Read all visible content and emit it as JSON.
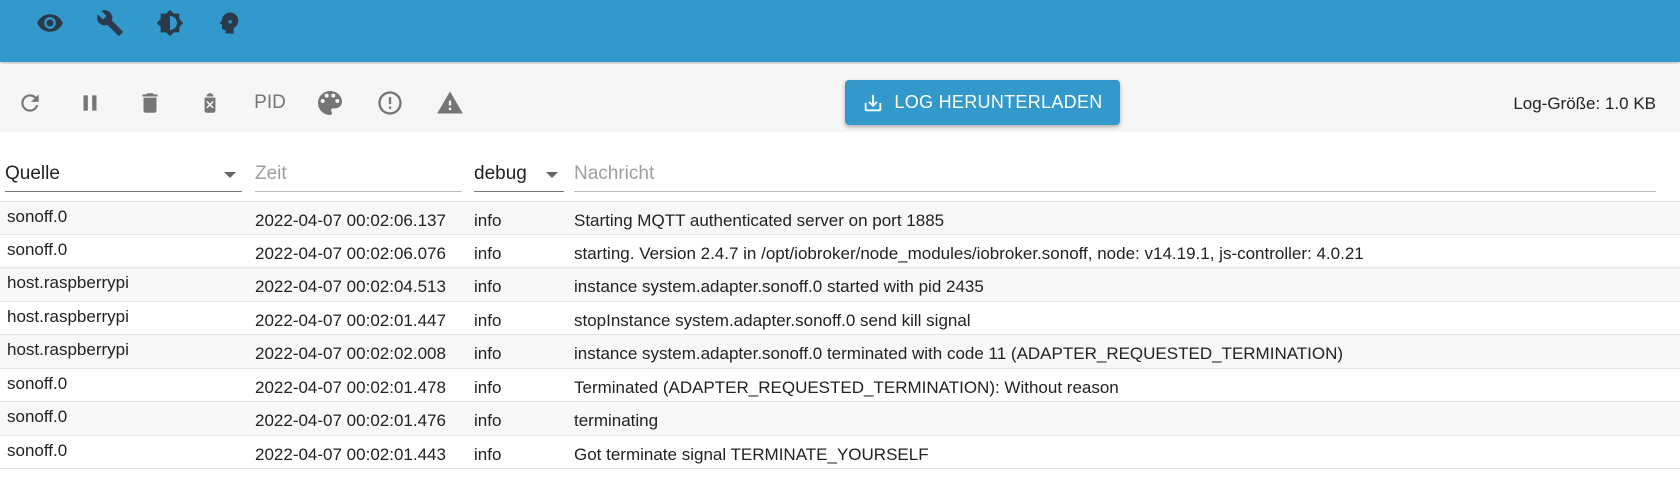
{
  "topbar": {
    "icons": [
      "eye-icon",
      "wrench-icon",
      "brightness-icon",
      "head-icon"
    ]
  },
  "toolbar": {
    "pid_label": "PID",
    "download_label": "LOG HERUNTERLADEN",
    "log_size": "Log-Größe: 1.0 KB"
  },
  "filters": {
    "source": "Quelle",
    "time_placeholder": "Zeit",
    "level": "debug",
    "message_placeholder": "Nachricht"
  },
  "rows": [
    {
      "source": "sonoff.0",
      "time": "2022-04-07 00:02:06.137",
      "severity": "info",
      "message": "Starting MQTT authenticated server on port 1885"
    },
    {
      "source": "sonoff.0",
      "time": "2022-04-07 00:02:06.076",
      "severity": "info",
      "message": "starting. Version 2.4.7 in /opt/iobroker/node_modules/iobroker.sonoff, node: v14.19.1, js-controller: 4.0.21"
    },
    {
      "source": "host.raspberrypi",
      "time": "2022-04-07 00:02:04.513",
      "severity": "info",
      "message": "instance system.adapter.sonoff.0 started with pid 2435"
    },
    {
      "source": "host.raspberrypi",
      "time": "2022-04-07 00:02:01.447",
      "severity": "info",
      "message": "stopInstance system.adapter.sonoff.0 send kill signal"
    },
    {
      "source": "host.raspberrypi",
      "time": "2022-04-07 00:02:02.008",
      "severity": "info",
      "message": "instance system.adapter.sonoff.0 terminated with code 11 (ADAPTER_REQUESTED_TERMINATION)"
    },
    {
      "source": "sonoff.0",
      "time": "2022-04-07 00:02:01.478",
      "severity": "info",
      "message": "Terminated (ADAPTER_REQUESTED_TERMINATION): Without reason"
    },
    {
      "source": "sonoff.0",
      "time": "2022-04-07 00:02:01.476",
      "severity": "info",
      "message": "terminating"
    },
    {
      "source": "sonoff.0",
      "time": "2022-04-07 00:02:01.443",
      "severity": "info",
      "message": "Got terminate signal TERMINATE_YOURSELF"
    }
  ]
}
